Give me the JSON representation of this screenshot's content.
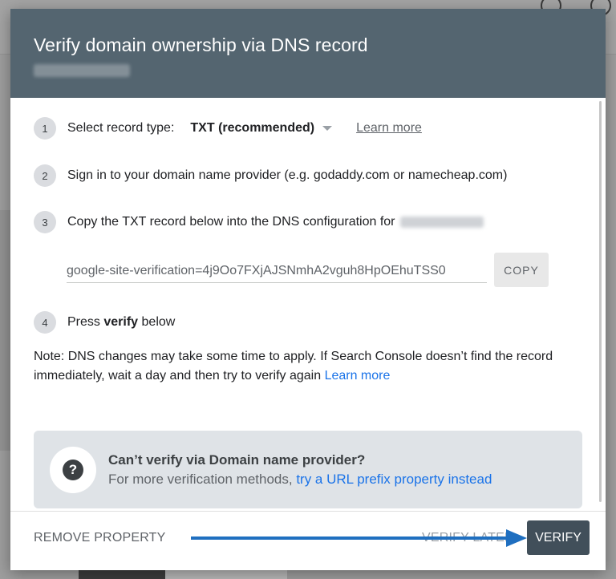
{
  "dialog": {
    "title": "Verify domain ownership via DNS record"
  },
  "steps": {
    "step1": {
      "number": "1",
      "label": "Select record type:",
      "record_type": "TXT (recommended)",
      "learn_more": "Learn more"
    },
    "step2": {
      "number": "2",
      "text": "Sign in to your domain name provider (e.g. godaddy.com or namecheap.com)"
    },
    "step3": {
      "number": "3",
      "text": "Copy the TXT record below into the DNS configuration for",
      "txt_record": "google-site-verification=4j9Oo7FXjAJSNmhA2vguh8HpOEhuTSS0",
      "copy_label": "COPY"
    },
    "step4": {
      "number": "4",
      "prefix": "Press",
      "bold": "verify",
      "suffix": "below"
    }
  },
  "note": {
    "text": "Note: DNS changes may take some time to apply. If Search Console doesn’t find the record immediately, wait a day and then try to verify again",
    "link": "Learn more"
  },
  "help_box": {
    "title": "Can’t verify via Domain name provider?",
    "text": "For more verification methods,",
    "link": "try a URL prefix property instead",
    "icon": "question-mark-icon"
  },
  "footer": {
    "remove_label": "REMOVE PROPERTY",
    "verify_later_label": "VERIFY LATER",
    "verify_label": "VERIFY"
  },
  "colors": {
    "header_bg": "#546570",
    "verify_bg": "#414f5a",
    "link": "#1a73e8",
    "arrow": "#1f6fc0"
  }
}
